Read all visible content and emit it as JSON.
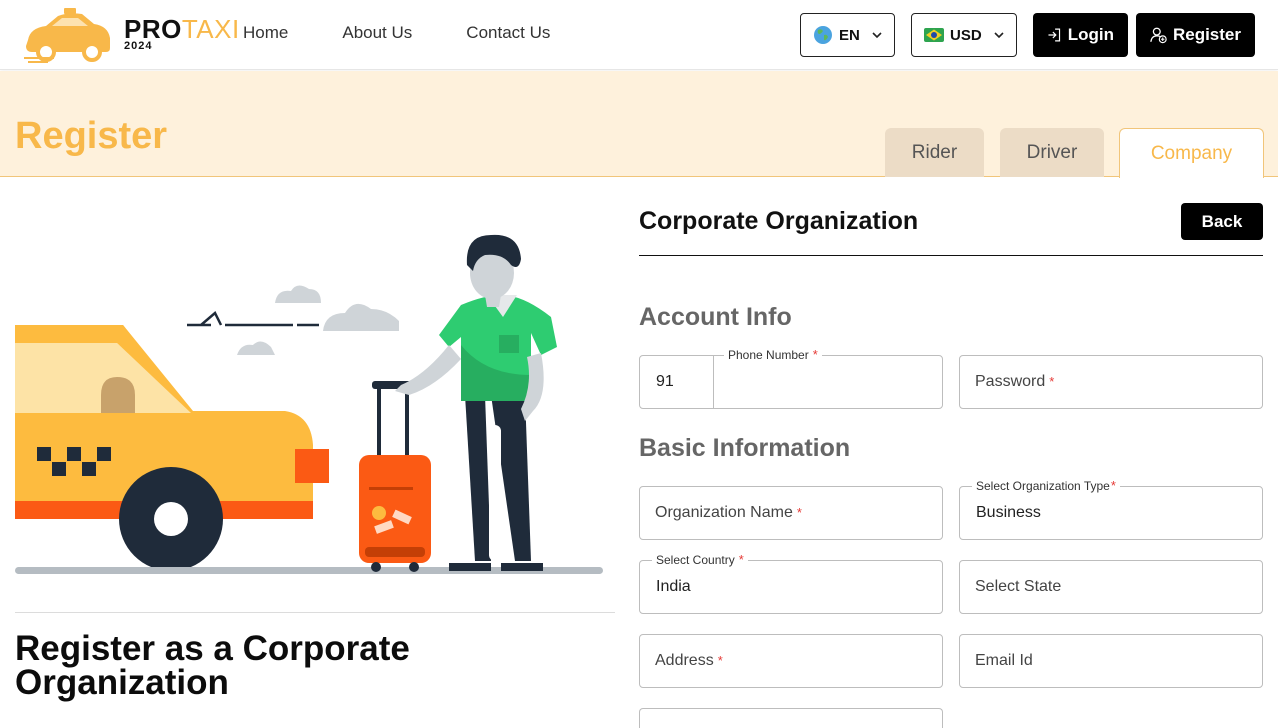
{
  "brand": {
    "name_pro": "PRO",
    "name_taxi": "TAXI",
    "year": "2024"
  },
  "nav": {
    "items": [
      "Home",
      "About Us",
      "Contact Us"
    ]
  },
  "language": {
    "flag_icon": "globe-icon",
    "value": "EN"
  },
  "currency": {
    "flag_icon": "brazil-flag-icon",
    "value": "USD"
  },
  "auth": {
    "login_label": "Login",
    "register_label": "Register"
  },
  "banner": {
    "title": "Register",
    "tabs": [
      {
        "label": "Rider",
        "active": false
      },
      {
        "label": "Driver",
        "active": false
      },
      {
        "label": "Company",
        "active": true
      }
    ]
  },
  "left": {
    "heading": "Register as a Corporate Organization"
  },
  "form": {
    "title": "Corporate Organization",
    "back_label": "Back",
    "sections": {
      "account": "Account Info",
      "basic": "Basic Information"
    },
    "fields": {
      "country_code": "91",
      "phone_label": "Phone Number",
      "password_label": "Password",
      "org_name_label": "Organization Name",
      "org_type_label": "Select Organization Type",
      "org_type_value": "Business",
      "country_label": "Select Country",
      "country_value": "India",
      "state_label": "Select State",
      "address_label": "Address",
      "email_label": "Email Id"
    },
    "required_mark": "*"
  },
  "colors": {
    "accent": "#f8b84a",
    "banner_bg": "#fef1dc",
    "tab_inactive": "#ecdcc6",
    "required": "#e53935"
  }
}
